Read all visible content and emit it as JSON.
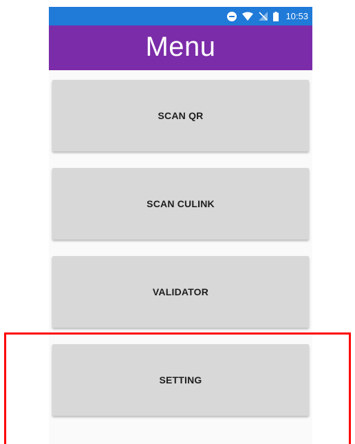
{
  "status_bar": {
    "time": "10:53",
    "icons": [
      "do-not-disturb-icon",
      "wifi-icon",
      "no-sim-icon",
      "battery-icon"
    ]
  },
  "app_bar": {
    "title": "Menu"
  },
  "menu": {
    "buttons": [
      {
        "label": "SCAN QR"
      },
      {
        "label": "SCAN CULINK"
      },
      {
        "label": "VALIDATOR"
      },
      {
        "label": "SETTING"
      }
    ]
  },
  "colors": {
    "status_bar": "#1f7ad8",
    "app_bar": "#7b2ca8",
    "button_bg": "#d7d8d7",
    "highlight": "#ff0000"
  }
}
